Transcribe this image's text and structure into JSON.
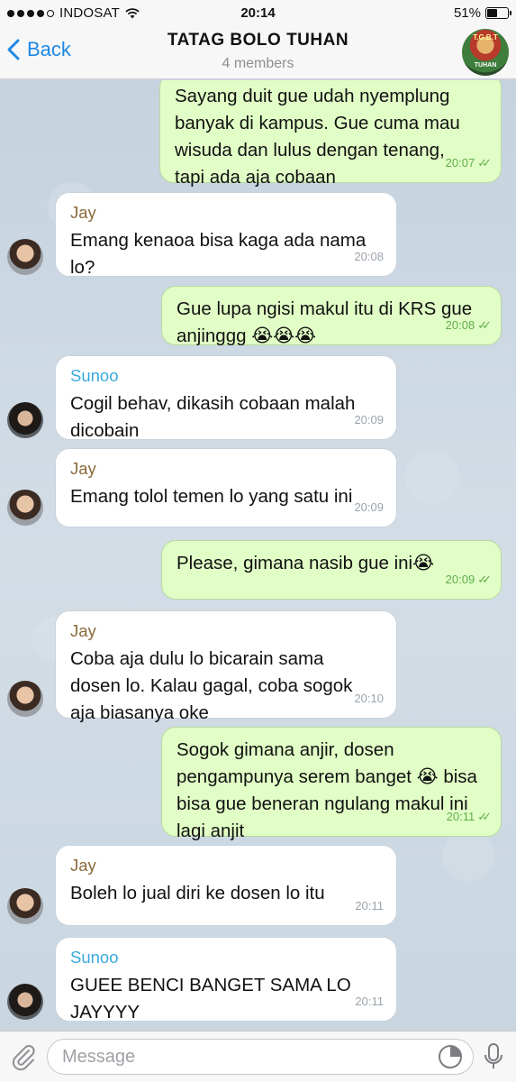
{
  "status": {
    "carrier": "INDOSAT",
    "time": "20:14",
    "battery": "51%",
    "battery_level": 0.51
  },
  "nav": {
    "back_label": "Back",
    "title": "TATAG BOLO TUHAN",
    "subtitle": "4 members",
    "avatar_text_top": "T.G.B.T",
    "avatar_text_bottom": "TUHAN"
  },
  "messages": [
    {
      "dir": "out",
      "lines": [
        "Sayang duit gue udah nyemplung",
        "banyak di kampus. Gue cuma mau",
        "wisuda dan lulus dengan tenang,",
        "tapi ada aja cobaan"
      ],
      "time": "20:07"
    },
    {
      "dir": "in",
      "sender": "Jay",
      "lines": [
        "Emang kenaoa bisa kaga ada nama",
        "lo?"
      ],
      "time": "20:08"
    },
    {
      "dir": "out",
      "lines": [
        "Gue lupa ngisi makul itu di KRS gue",
        "anjinggg 😭😭😭"
      ],
      "time": "20:08"
    },
    {
      "dir": "in",
      "sender": "Sunoo",
      "lines": [
        "Cogil behav, dikasih cobaan malah",
        "dicobain"
      ],
      "time": "20:09"
    },
    {
      "dir": "in",
      "sender": "Jay",
      "lines": [
        "Emang tolol temen lo yang satu ini"
      ],
      "time": "20:09"
    },
    {
      "dir": "out",
      "lines": [
        "Please, gimana nasib gue ini😭"
      ],
      "time": "20:09"
    },
    {
      "dir": "in",
      "sender": "Jay",
      "lines": [
        "Coba aja dulu lo bicarain sama",
        "dosen lo. Kalau gagal, coba sogok",
        "aja biasanya oke"
      ],
      "time": "20:10"
    },
    {
      "dir": "out",
      "lines": [
        "Sogok gimana anjir, dosen",
        "pengampunya serem banget 😭 bisa",
        "bisa gue beneran ngulang makul ini",
        "lagi anjit"
      ],
      "time": "20:11"
    },
    {
      "dir": "in",
      "sender": "Jay",
      "lines": [
        "Boleh lo jual diri ke dosen lo itu"
      ],
      "time": "20:11"
    },
    {
      "dir": "in",
      "sender": "Sunoo",
      "lines": [
        "GUEE BENCI BANGET SAMA LO",
        "JAYYYY"
      ],
      "time": "20:11"
    }
  ],
  "input": {
    "placeholder": "Message"
  },
  "icons": {
    "back": "chevron-left-icon",
    "attach": "paperclip-icon",
    "sticker": "sticker-icon",
    "mic": "microphone-icon"
  },
  "colors": {
    "accent": "#1e88e5",
    "outgoing_bubble": "#e1fec6",
    "incoming_bubble": "#ffffff",
    "jay_name": "#8a6a3a",
    "sunoo_name": "#3aa9db"
  }
}
